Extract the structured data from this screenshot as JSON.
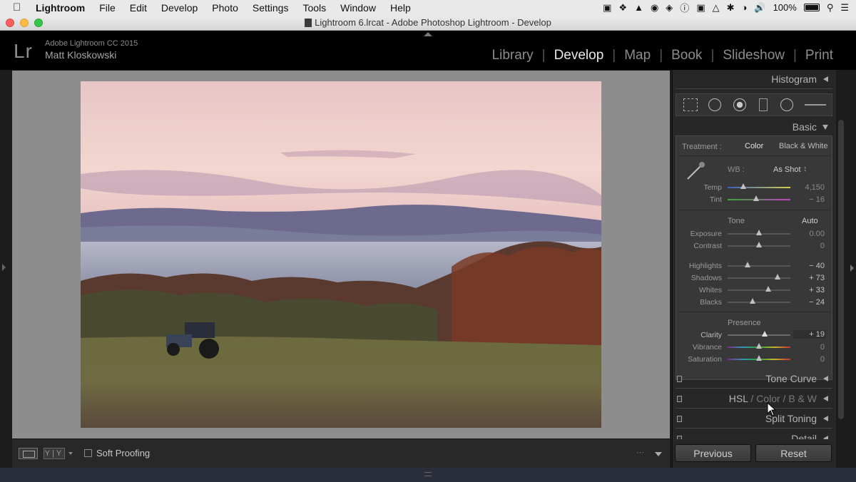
{
  "menubar": {
    "app": "Lightroom",
    "items": [
      "File",
      "Edit",
      "Develop",
      "Photo",
      "Settings",
      "Tools",
      "Window",
      "Help"
    ],
    "battery": "100%"
  },
  "window": {
    "title": "Lightroom 6.lrcat - Adobe Photoshop Lightroom - Develop"
  },
  "identity": {
    "logo": "Lr",
    "product": "Adobe Lightroom CC 2015",
    "user": "Matt Kloskowski"
  },
  "modules": [
    "Library",
    "Develop",
    "Map",
    "Book",
    "Slideshow",
    "Print"
  ],
  "active_module": "Develop",
  "panel": {
    "histogram": "Histogram",
    "basic": "Basic",
    "treatment_label": "Treatment :",
    "treatment_color": "Color",
    "treatment_bw": "Black & White",
    "wb_label": "WB :",
    "wb_value": "As Shot",
    "temp": {
      "label": "Temp",
      "value": "4,150",
      "pos": 0.25
    },
    "tint": {
      "label": "Tint",
      "value": "− 16",
      "pos": 0.45
    },
    "tone_label": "Tone",
    "auto": "Auto",
    "exposure": {
      "label": "Exposure",
      "value": "0.00",
      "pos": 0.5
    },
    "contrast": {
      "label": "Contrast",
      "value": "0",
      "pos": 0.5
    },
    "highlights": {
      "label": "Highlights",
      "value": "− 40",
      "pos": 0.32
    },
    "shadows": {
      "label": "Shadows",
      "value": "+ 73",
      "pos": 0.8
    },
    "whites": {
      "label": "Whites",
      "value": "+ 33",
      "pos": 0.65
    },
    "blacks": {
      "label": "Blacks",
      "value": "− 24",
      "pos": 0.4
    },
    "presence_label": "Presence",
    "clarity": {
      "label": "Clarity",
      "value": "+ 19",
      "pos": 0.59
    },
    "vibrance": {
      "label": "Vibrance",
      "value": "0",
      "pos": 0.5
    },
    "saturation": {
      "label": "Saturation",
      "value": "0",
      "pos": 0.5
    },
    "tone_curve": "Tone Curve",
    "hsl": "HSL",
    "hsl_color": "Color",
    "hsl_bw": "B & W",
    "split_toning": "Split Toning",
    "detail": "Detail",
    "previous": "Previous",
    "reset": "Reset"
  },
  "toolbar": {
    "yy": "Y|Y",
    "soft_proofing": "Soft Proofing"
  }
}
